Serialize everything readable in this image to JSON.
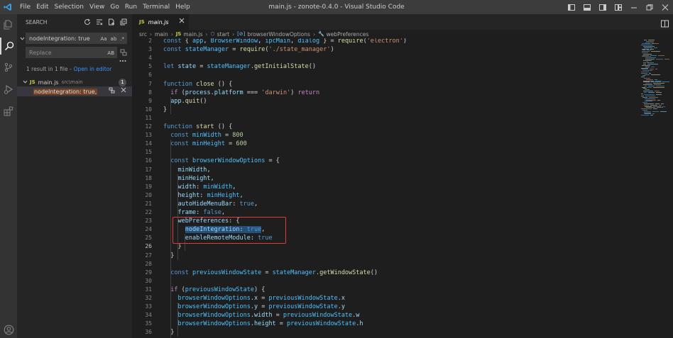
{
  "titlebar": {
    "menu": [
      "File",
      "Edit",
      "Selection",
      "View",
      "Go",
      "Run",
      "Terminal",
      "Help"
    ],
    "title": "main.js - zonote-0.4.0 - Visual Studio Code"
  },
  "activity_bar": {
    "icons": [
      "explorer-icon",
      "search-icon",
      "source-control-icon",
      "run-debug-icon",
      "extensions-icon",
      "account-icon"
    ],
    "active": "search-icon"
  },
  "search": {
    "header_label": "SEARCH",
    "query": "nodeIntegration: true",
    "query_options": [
      "Aa",
      "ab",
      ".*"
    ],
    "replace_placeholder": "Replace",
    "replace_option": "AB",
    "result_message": "1 result in 1 file -",
    "open_in_editor": "Open in editor",
    "file": {
      "name": "main.js",
      "path": "src\\main",
      "count": "1"
    },
    "match": "nodeIntegration: true,"
  },
  "editor": {
    "tab_label": "main.js",
    "breadcrumbs": [
      "src",
      "main",
      "main.js",
      "start",
      "browserWindowOptions",
      "webPreferences"
    ],
    "current_line": 26,
    "lines": [
      {
        "n": 2,
        "html": "<span class=\"kw\">const</span> { <span class=\"cst\">app</span>, <span class=\"cst\">BrowserWindow</span>, <span class=\"cst\">ipcMain</span>, <span class=\"cst\">dialog</span> } = <span class=\"fn\">require</span>(<span class=\"str\">'electron'</span>)"
      },
      {
        "n": 3,
        "html": "<span class=\"kw\">const</span> <span class=\"cst\">stateManager</span> = <span class=\"fn\">require</span>(<span class=\"str\">'./state_manager'</span>)"
      },
      {
        "n": 4,
        "html": ""
      },
      {
        "n": 5,
        "html": "<span class=\"kw\">let</span> <span class=\"var\">state</span> = <span class=\"cst\">stateManager</span>.<span class=\"fn\">getInitialState</span>()"
      },
      {
        "n": 6,
        "html": ""
      },
      {
        "n": 7,
        "html": "<span class=\"kw\">function</span> <span class=\"fn\">close</span> () {"
      },
      {
        "n": 8,
        "html": "  <span class=\"kw2\">if</span> (<span class=\"var\">process</span>.<span class=\"var\">platform</span> === <span class=\"str\">'darwin'</span>) <span class=\"kw2\">return</span>"
      },
      {
        "n": 9,
        "html": "  <span class=\"var\">app</span>.<span class=\"fn\">quit</span>()"
      },
      {
        "n": 10,
        "html": "}"
      },
      {
        "n": 11,
        "html": ""
      },
      {
        "n": 12,
        "html": "<span class=\"kw\">function</span> <span class=\"fn\">start</span> () {"
      },
      {
        "n": 13,
        "html": "  <span class=\"kw\">const</span> <span class=\"cst\">minWidth</span> = <span class=\"num\">800</span>"
      },
      {
        "n": 14,
        "html": "  <span class=\"kw\">const</span> <span class=\"cst\">minHeight</span> = <span class=\"num\">600</span>"
      },
      {
        "n": 15,
        "html": ""
      },
      {
        "n": 16,
        "html": "  <span class=\"kw\">const</span> <span class=\"cst\">browserWindowOptions</span> = {"
      },
      {
        "n": 17,
        "html": "    <span class=\"var\">minWidth</span>,"
      },
      {
        "n": 18,
        "html": "    <span class=\"var\">minHeight</span>,"
      },
      {
        "n": 19,
        "html": "    <span class=\"var\">width</span>: <span class=\"cst\">minWidth</span>,"
      },
      {
        "n": 20,
        "html": "    <span class=\"var\">height</span>: <span class=\"cst\">minHeight</span>,"
      },
      {
        "n": 21,
        "html": "    <span class=\"var\">autoHideMenuBar</span>: <span class=\"kw\">true</span>,"
      },
      {
        "n": 22,
        "html": "    <span class=\"var\">frame</span>: <span class=\"kw\">false</span>,"
      },
      {
        "n": 23,
        "html": "    <span class=\"var\">webPreferences</span>: {"
      },
      {
        "n": 24,
        "html": "      <span class=\"sel\"><span class=\"var\">nodeIntegration</span>: <span class=\"kw\">true</span></span>,"
      },
      {
        "n": 25,
        "html": "      <span class=\"var\">enableRemoteModule</span>: <span class=\"kw\">true</span>"
      },
      {
        "n": 26,
        "html": "    }"
      },
      {
        "n": 27,
        "html": "  }"
      },
      {
        "n": 28,
        "html": ""
      },
      {
        "n": 29,
        "html": "  <span class=\"kw\">const</span> <span class=\"cst\">previousWindowState</span> = <span class=\"cst\">stateManager</span>.<span class=\"fn\">getWindowState</span>()"
      },
      {
        "n": 30,
        "html": ""
      },
      {
        "n": 31,
        "html": "  <span class=\"kw2\">if</span> (<span class=\"cst\">previousWindowState</span>) {"
      },
      {
        "n": 32,
        "html": "    <span class=\"cst\">browserWindowOptions</span>.<span class=\"var\">x</span> = <span class=\"cst\">previousWindowState</span>.<span class=\"var\">x</span>"
      },
      {
        "n": 33,
        "html": "    <span class=\"cst\">browserWindowOptions</span>.<span class=\"var\">y</span> = <span class=\"cst\">previousWindowState</span>.<span class=\"var\">y</span>"
      },
      {
        "n": 34,
        "html": "    <span class=\"cst\">browserWindowOptions</span>.<span class=\"var\">width</span> = <span class=\"cst\">previousWindowState</span>.<span class=\"var\">w</span>"
      },
      {
        "n": 35,
        "html": "    <span class=\"cst\">browserWindowOptions</span>.<span class=\"var\">height</span> = <span class=\"cst\">previousWindowState</span>.<span class=\"var\">h</span>"
      },
      {
        "n": 36,
        "html": "  }"
      }
    ]
  },
  "colors": {
    "accent_link": "#3794ff",
    "highlight_box": "#e03a3a",
    "selection": "#264f78"
  }
}
